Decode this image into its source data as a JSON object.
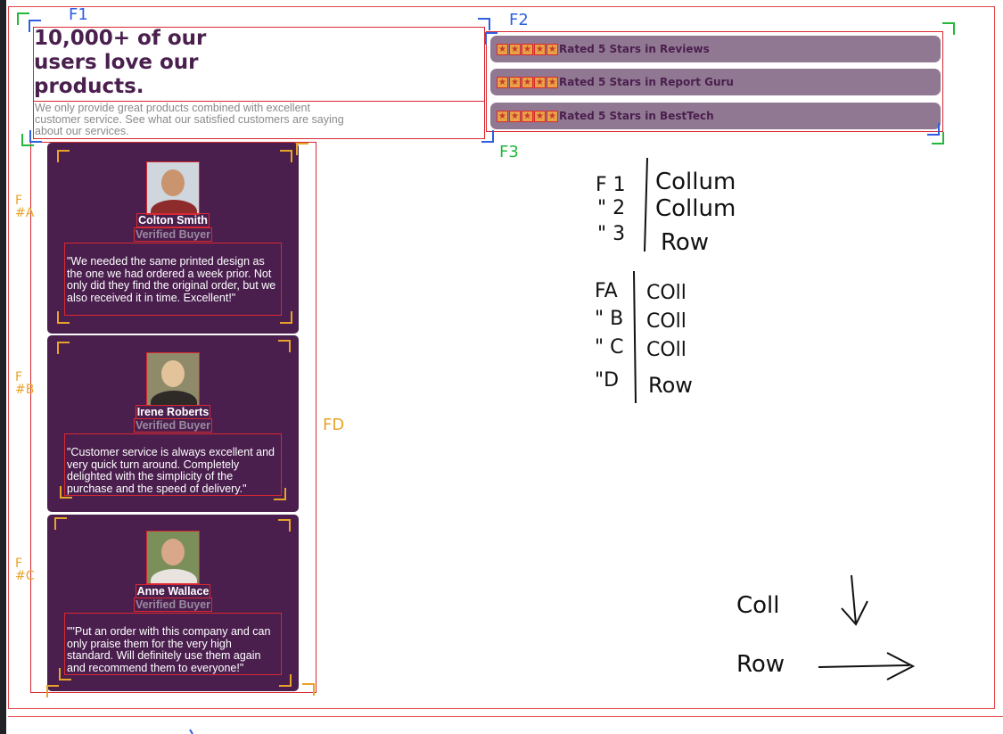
{
  "headline": "10,000+ of our users love our products.",
  "subtext": "We only provide great products combined with excellent customer service. See what our satisfied customers are saying about our services.",
  "ratings": [
    {
      "text": "Rated 5 Stars in Reviews",
      "stars": 5
    },
    {
      "text": "Rated 5 Stars in Report Guru",
      "stars": 5
    },
    {
      "text": "Rated 5 Stars in BestTech",
      "stars": 5
    }
  ],
  "testimonials": [
    {
      "name": "Colton Smith",
      "badge": "Verified Buyer",
      "quote": "\"We needed the same printed design as the one we had ordered a week prior. Not only did they find the original order, but we also received it in time. Excellent!\""
    },
    {
      "name": "Irene Roberts",
      "badge": "Verified Buyer",
      "quote": "\"Customer service is always excellent and very quick turn around. Completely delighted with the simplicity of the purchase and the speed of delivery.\""
    },
    {
      "name": "Anne Wallace",
      "badge": "Verified Buyer",
      "quote": "\"\"Put an order with this company and can only praise them for the very high standard. Will definitely use them again and recommend them to everyone!\""
    }
  ],
  "annotations": {
    "f1": "F1",
    "f2": "F2",
    "f3": "F3",
    "fd": "FD",
    "fa": "F\n#A",
    "fb": "F\n#B",
    "fc": "F\n#C",
    "table1": [
      {
        "key": "F 1",
        "value": "Collum"
      },
      {
        "key": "\" 2",
        "value": "Collum"
      },
      {
        "key": "\" 3",
        "value": "Row"
      }
    ],
    "table2": [
      {
        "key": "FA",
        "value": "COll"
      },
      {
        "key": "\" B",
        "value": "COll"
      },
      {
        "key": "\" C",
        "value": "COll"
      },
      {
        "key": "\"D",
        "value": "Row"
      }
    ],
    "legend": [
      {
        "label": "Coll"
      },
      {
        "label": "Row"
      }
    ]
  },
  "colors": {
    "brand_purple": "#4a1f4e",
    "rating_bg": "#917892",
    "star": "#e8a245",
    "outline_red": "#d8282f",
    "anno_green": "#22b83a",
    "anno_blue": "#2f5ee0",
    "anno_orange": "#e8a42a"
  }
}
